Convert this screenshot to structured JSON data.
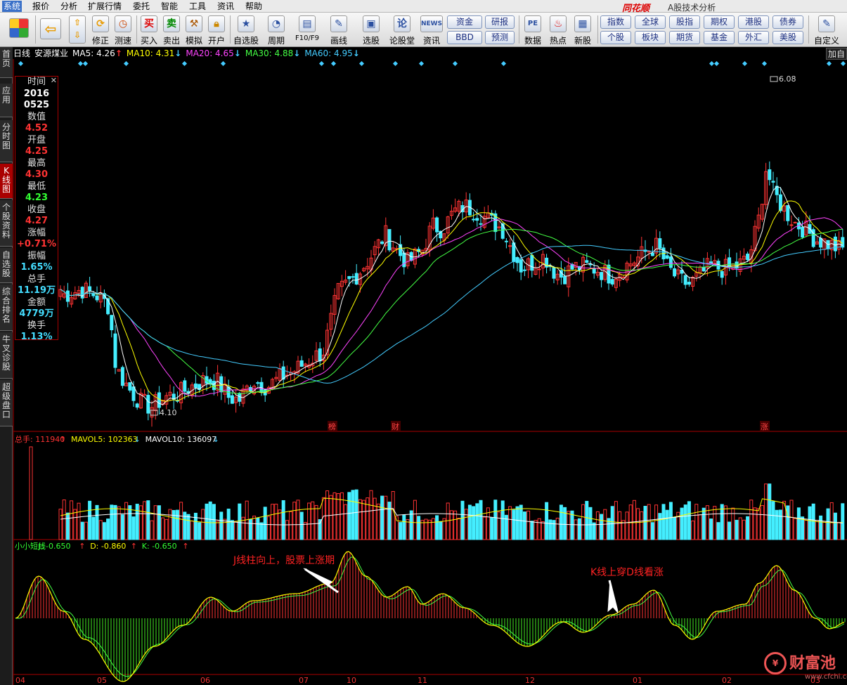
{
  "menu": [
    "系统",
    "报价",
    "分析",
    "扩展行情",
    "委托",
    "智能",
    "工具",
    "资讯",
    "帮助"
  ],
  "app": {
    "title": "同花顺",
    "subtitle": "A股技术分析"
  },
  "toolbar": {
    "buttons": [
      {
        "label": "",
        "icon": "grid-icon"
      },
      {
        "label": "",
        "icon": "back-arrow-icon"
      },
      {
        "label": "",
        "icon": "up-down-arrow-icon"
      },
      {
        "label": "修正",
        "icon": "refresh-icon"
      },
      {
        "label": "测速",
        "icon": "clock-icon"
      },
      {
        "label": "买入",
        "icon": "buy-icon"
      },
      {
        "label": "卖出",
        "icon": "sell-icon"
      },
      {
        "label": "模拟",
        "icon": "hammer-icon"
      },
      {
        "label": "开户",
        "icon": "lock-icon"
      },
      {
        "label": "自选股",
        "icon": "star-icon"
      },
      {
        "label": "周期",
        "icon": "cycle-icon"
      },
      {
        "label": "F10/F9",
        "icon": "f10-icon"
      },
      {
        "label": "画线",
        "icon": "pen-icon"
      },
      {
        "label": "选股",
        "icon": "select-stock-icon"
      },
      {
        "label": "论股堂",
        "icon": "forum-icon"
      },
      {
        "label": "资讯",
        "icon": "news-icon"
      },
      {
        "label": "数据",
        "icon": "pe-icon"
      },
      {
        "label": "热点",
        "icon": "hot-icon"
      },
      {
        "label": "新股",
        "icon": "new-stock-icon"
      },
      {
        "label": "自定义",
        "icon": "custom-icon"
      }
    ],
    "pills": [
      "资金",
      "BBD",
      "研报",
      "预测",
      "指数",
      "个股",
      "全球",
      "板块",
      "股指",
      "期货",
      "期权",
      "基金",
      "港股",
      "外汇",
      "债券",
      "美股"
    ]
  },
  "leftnav": [
    "首页",
    "应用",
    "分时图",
    "K线图",
    "个股资料",
    "自选股",
    "综合排名",
    "牛叉诊股",
    "超级盘口"
  ],
  "header": {
    "period": "日线",
    "stock": "安源煤业",
    "ma": [
      {
        "label": "MA5: 4.26",
        "arrow": "↑",
        "color": "#ffffff"
      },
      {
        "label": "MA10: 4.31",
        "arrow": "↓",
        "color": "#ffff00"
      },
      {
        "label": "MA20: 4.65",
        "arrow": "↓",
        "color": "#ff44ff"
      },
      {
        "label": "MA30: 4.88",
        "arrow": "↓",
        "color": "#44ff44"
      },
      {
        "label": "MA60: 4.95",
        "arrow": "↓",
        "color": "#44ccff"
      }
    ],
    "add_button": "加自"
  },
  "info": {
    "rows": [
      {
        "label": "时间",
        "value": "2016",
        "color": "#ffffff"
      },
      {
        "label": "",
        "value": "0525",
        "color": "#ffffff"
      },
      {
        "label": "数值",
        "value": "4.52",
        "color": "#ff3333"
      },
      {
        "label": "开盘",
        "value": "4.25",
        "color": "#ff3333"
      },
      {
        "label": "最高",
        "value": "4.30",
        "color": "#ff3333"
      },
      {
        "label": "最低",
        "value": "4.23",
        "color": "#33ff33"
      },
      {
        "label": "收盘",
        "value": "4.27",
        "color": "#ff3333"
      },
      {
        "label": "涨幅",
        "value": "+0.71%",
        "color": "#ff3333"
      },
      {
        "label": "振幅",
        "value": "1.65%",
        "color": "#44ddff"
      },
      {
        "label": "总手",
        "value": "11.19万",
        "color": "#44ddff"
      },
      {
        "label": "金额",
        "value": "4779万",
        "color": "#44ddff"
      },
      {
        "label": "换手",
        "value": "1.13%",
        "color": "#44ddff"
      }
    ]
  },
  "price_labels": {
    "high": "6.08",
    "low": "4.10"
  },
  "event_markers": [
    "榜",
    "财",
    "涨"
  ],
  "volume_header": [
    {
      "label": "总手: 111940",
      "arrow": "↑",
      "color": "#ff3333"
    },
    {
      "label": "MAVOL5: 102363",
      "arrow": "↓",
      "color": "#ffff00"
    },
    {
      "label": "MAVOL10: 136097",
      "arrow": "↓",
      "color": "#ffffff"
    }
  ],
  "kdj_header": [
    {
      "label": "小小短线",
      "arrow": "",
      "color": "#33ff33"
    },
    {
      "label": "J: -0.650",
      "arrow": "↑",
      "color": "#33ff33"
    },
    {
      "label": "D: -0.860",
      "arrow": "↑",
      "color": "#ffff00"
    },
    {
      "label": "K: -0.650",
      "arrow": "↑",
      "color": "#33ff33"
    }
  ],
  "annotations": [
    "J线柱向上，股票上涨期",
    "K线上穿D线看涨"
  ],
  "x_axis": [
    "04",
    "05",
    "06",
    "07",
    "10",
    "11",
    "12",
    "01",
    "02",
    "03"
  ],
  "watermark": {
    "name": "财富池",
    "url": "www.cfchi.com"
  },
  "colors": {
    "up": "#ff3333",
    "down": "#44eeff",
    "ma5": "#ffffff",
    "ma10": "#ffff00",
    "ma20": "#ff44ff",
    "ma30": "#44ff44",
    "ma60": "#44ccff"
  }
}
